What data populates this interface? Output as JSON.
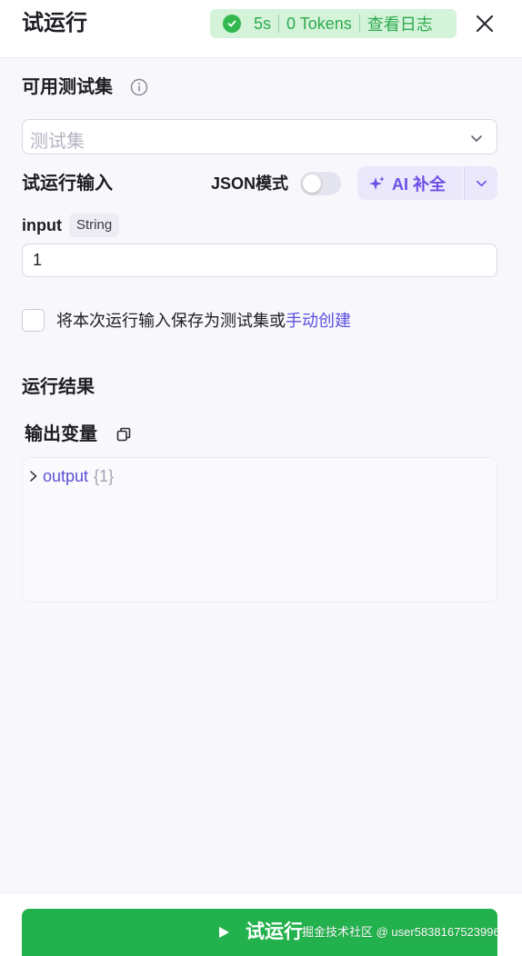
{
  "header": {
    "title": "试运行",
    "status": {
      "duration": "5s",
      "tokens": "0 Tokens",
      "view_log": "查看日志",
      "status_color": "#33b84f"
    },
    "close_icon": "close-icon"
  },
  "test_set": {
    "label": "可用测试集",
    "info_icon": "info-icon",
    "select_placeholder": "测试集"
  },
  "run_input": {
    "label": "试运行输入",
    "json_mode_label": "JSON模式",
    "json_mode_on": false,
    "ai_button_label": "AI 补全",
    "accent_color": "#6b4ee6"
  },
  "input_field": {
    "name": "input",
    "type": "String",
    "value": "1"
  },
  "save_option": {
    "text": "将本次运行输入保存为测试集或",
    "link": "手动创建",
    "checked": false
  },
  "results": {
    "label": "运行结果",
    "output_vars_label": "输出变量",
    "output": {
      "key": "output",
      "count": "{1}"
    }
  },
  "footer": {
    "run_label": "试运行",
    "run_color": "#22b14c",
    "watermark": "掘金技术社区 @ user5838167523996"
  }
}
